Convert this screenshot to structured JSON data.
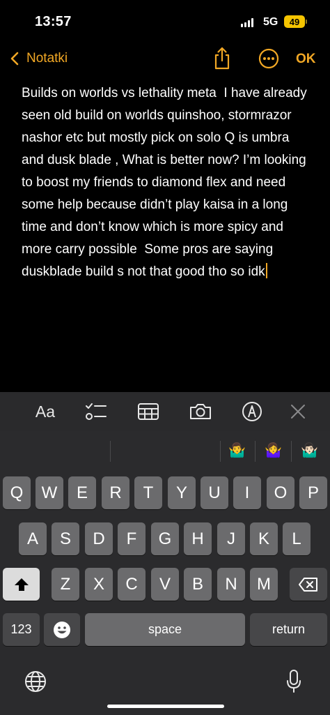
{
  "status_bar": {
    "time": "13:57",
    "network": "5G",
    "battery": "49"
  },
  "nav": {
    "back_label": "Notatki",
    "done_label": "OK"
  },
  "note": {
    "text": "Builds on worlds vs lethality meta  I have already seen old build on worlds quinshoo, stormrazor nashor etc but mostly pick on solo Q is umbra and dusk blade , What is better now? I’m looking to boost my friends to diamond flex and need some help because didn’t play kaisa in a long time and don’t know which is more spicy and more carry possible  Some pros are saying duskblade build s not that good tho so idk"
  },
  "toolbar": {
    "format_label": "Aa"
  },
  "predictions": [
    "🤷‍♂️",
    "🤷‍♀️",
    "🤷🏻‍♂️"
  ],
  "keyboard": {
    "row1": [
      "Q",
      "W",
      "E",
      "R",
      "T",
      "Y",
      "U",
      "I",
      "O",
      "P"
    ],
    "row2": [
      "A",
      "S",
      "D",
      "F",
      "G",
      "H",
      "J",
      "K",
      "L"
    ],
    "row3": [
      "Z",
      "X",
      "C",
      "V",
      "B",
      "N",
      "M"
    ],
    "numbers_label": "123",
    "space_label": "space",
    "return_label": "return"
  },
  "colors": {
    "accent": "#f2a825",
    "background": "#000000",
    "keyboard_bg": "#2b2b2d",
    "key": "#6b6b6d"
  }
}
